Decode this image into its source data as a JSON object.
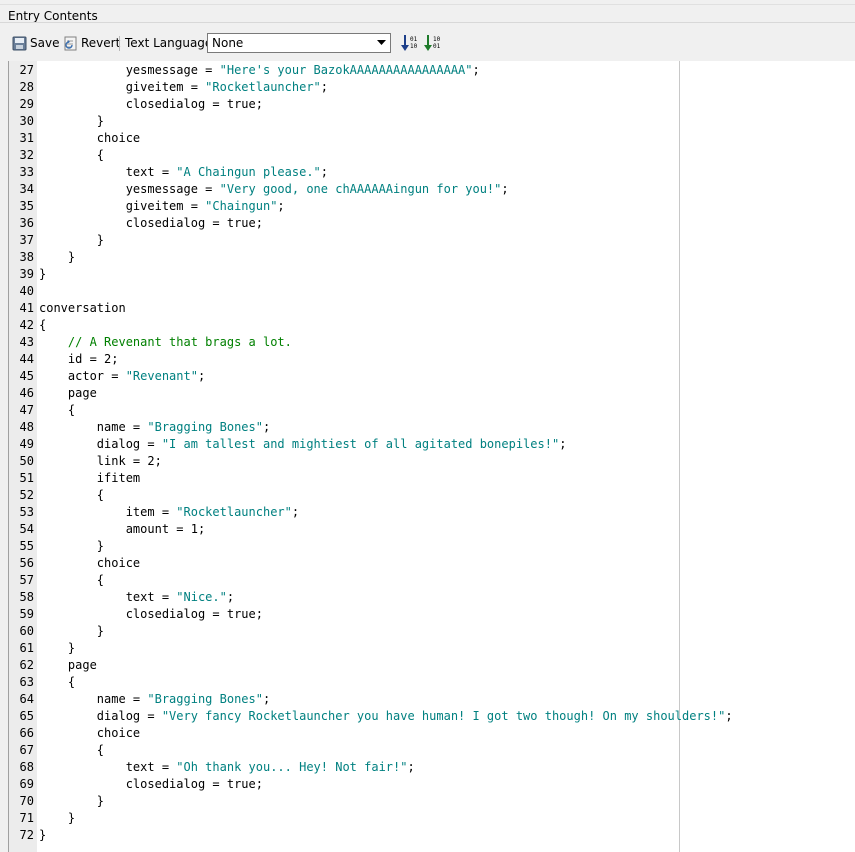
{
  "panel": {
    "title": "Entry Contents"
  },
  "toolbar": {
    "save_label": "Save",
    "revert_label": "Revert",
    "language_label": "Text Language:",
    "language_value": "None",
    "icons": [
      "save-icon",
      "revert-icon",
      "sort-ascending-icon",
      "sort-descending-icon"
    ]
  },
  "colors": {
    "string": "#008080",
    "comment": "#008000",
    "gutter": "#ececec"
  },
  "editor": {
    "lines": [
      {
        "n": "27",
        "t": [
          [
            "            yesmessage = ",
            ""
          ],
          [
            "\"Here's your BazokAAAAAAAAAAAAAAAA\"",
            "str"
          ],
          [
            ";",
            ""
          ]
        ]
      },
      {
        "n": "28",
        "t": [
          [
            "            giveitem = ",
            ""
          ],
          [
            "\"Rocketlauncher\"",
            "str"
          ],
          [
            ";",
            ""
          ]
        ]
      },
      {
        "n": "29",
        "t": [
          [
            "            closedialog = true;",
            ""
          ]
        ]
      },
      {
        "n": "30",
        "t": [
          [
            "        }",
            ""
          ]
        ]
      },
      {
        "n": "31",
        "t": [
          [
            "        choice",
            ""
          ]
        ]
      },
      {
        "n": "32",
        "t": [
          [
            "        {",
            ""
          ]
        ]
      },
      {
        "n": "33",
        "t": [
          [
            "            text = ",
            ""
          ],
          [
            "\"A Chaingun please.\"",
            "str"
          ],
          [
            ";",
            ""
          ]
        ]
      },
      {
        "n": "34",
        "t": [
          [
            "            yesmessage = ",
            ""
          ],
          [
            "\"Very good, one chAAAAAAingun for you!\"",
            "str"
          ],
          [
            ";",
            ""
          ]
        ]
      },
      {
        "n": "35",
        "t": [
          [
            "            giveitem = ",
            ""
          ],
          [
            "\"Chaingun\"",
            "str"
          ],
          [
            ";",
            ""
          ]
        ]
      },
      {
        "n": "36",
        "t": [
          [
            "            closedialog = true;",
            ""
          ]
        ]
      },
      {
        "n": "37",
        "t": [
          [
            "        }",
            ""
          ]
        ]
      },
      {
        "n": "38",
        "t": [
          [
            "    }",
            ""
          ]
        ]
      },
      {
        "n": "39",
        "t": [
          [
            "}",
            ""
          ]
        ]
      },
      {
        "n": "40",
        "t": [
          [
            "",
            ""
          ]
        ]
      },
      {
        "n": "41",
        "t": [
          [
            "conversation",
            ""
          ]
        ]
      },
      {
        "n": "42",
        "t": [
          [
            "{",
            ""
          ]
        ]
      },
      {
        "n": "43",
        "t": [
          [
            "    ",
            ""
          ],
          [
            "// A Revenant that brags a lot.",
            "cmt"
          ]
        ]
      },
      {
        "n": "44",
        "t": [
          [
            "    id = 2;",
            ""
          ]
        ]
      },
      {
        "n": "45",
        "t": [
          [
            "    actor = ",
            ""
          ],
          [
            "\"Revenant\"",
            "str"
          ],
          [
            ";",
            ""
          ]
        ]
      },
      {
        "n": "46",
        "t": [
          [
            "    page",
            ""
          ]
        ]
      },
      {
        "n": "47",
        "t": [
          [
            "    {",
            ""
          ]
        ]
      },
      {
        "n": "48",
        "t": [
          [
            "        name = ",
            ""
          ],
          [
            "\"Bragging Bones\"",
            "str"
          ],
          [
            ";",
            ""
          ]
        ]
      },
      {
        "n": "49",
        "t": [
          [
            "        dialog = ",
            ""
          ],
          [
            "\"I am tallest and mightiest of all agitated bonepiles!\"",
            "str"
          ],
          [
            ";",
            ""
          ]
        ]
      },
      {
        "n": "50",
        "t": [
          [
            "        link = 2;",
            ""
          ]
        ]
      },
      {
        "n": "51",
        "t": [
          [
            "        ifitem",
            ""
          ]
        ]
      },
      {
        "n": "52",
        "t": [
          [
            "        {",
            ""
          ]
        ]
      },
      {
        "n": "53",
        "t": [
          [
            "            item = ",
            ""
          ],
          [
            "\"Rocketlauncher\"",
            "str"
          ],
          [
            ";",
            ""
          ]
        ]
      },
      {
        "n": "54",
        "t": [
          [
            "            amount = 1;",
            ""
          ]
        ]
      },
      {
        "n": "55",
        "t": [
          [
            "        }",
            ""
          ]
        ]
      },
      {
        "n": "56",
        "t": [
          [
            "        choice",
            ""
          ]
        ]
      },
      {
        "n": "57",
        "t": [
          [
            "        {",
            ""
          ]
        ]
      },
      {
        "n": "58",
        "t": [
          [
            "            text = ",
            ""
          ],
          [
            "\"Nice.\"",
            "str"
          ],
          [
            ";",
            ""
          ]
        ]
      },
      {
        "n": "59",
        "t": [
          [
            "            closedialog = true;",
            ""
          ]
        ]
      },
      {
        "n": "60",
        "t": [
          [
            "        }",
            ""
          ]
        ]
      },
      {
        "n": "61",
        "t": [
          [
            "    }",
            ""
          ]
        ]
      },
      {
        "n": "62",
        "t": [
          [
            "    page",
            ""
          ]
        ]
      },
      {
        "n": "63",
        "t": [
          [
            "    {",
            ""
          ]
        ]
      },
      {
        "n": "64",
        "t": [
          [
            "        name = ",
            ""
          ],
          [
            "\"Bragging Bones\"",
            "str"
          ],
          [
            ";",
            ""
          ]
        ]
      },
      {
        "n": "65",
        "t": [
          [
            "        dialog = ",
            ""
          ],
          [
            "\"Very fancy Rocketlauncher you have human! I got two though! On my shoulders!\"",
            "str"
          ],
          [
            ";",
            ""
          ]
        ]
      },
      {
        "n": "66",
        "t": [
          [
            "        choice",
            ""
          ]
        ]
      },
      {
        "n": "67",
        "t": [
          [
            "        {",
            ""
          ]
        ]
      },
      {
        "n": "68",
        "t": [
          [
            "            text = ",
            ""
          ],
          [
            "\"Oh thank you... Hey! Not fair!\"",
            "str"
          ],
          [
            ";",
            ""
          ]
        ]
      },
      {
        "n": "69",
        "t": [
          [
            "            closedialog = true;",
            ""
          ]
        ]
      },
      {
        "n": "70",
        "t": [
          [
            "        }",
            ""
          ]
        ]
      },
      {
        "n": "71",
        "t": [
          [
            "    }",
            ""
          ]
        ]
      },
      {
        "n": "72",
        "t": [
          [
            "}",
            ""
          ]
        ]
      }
    ]
  }
}
